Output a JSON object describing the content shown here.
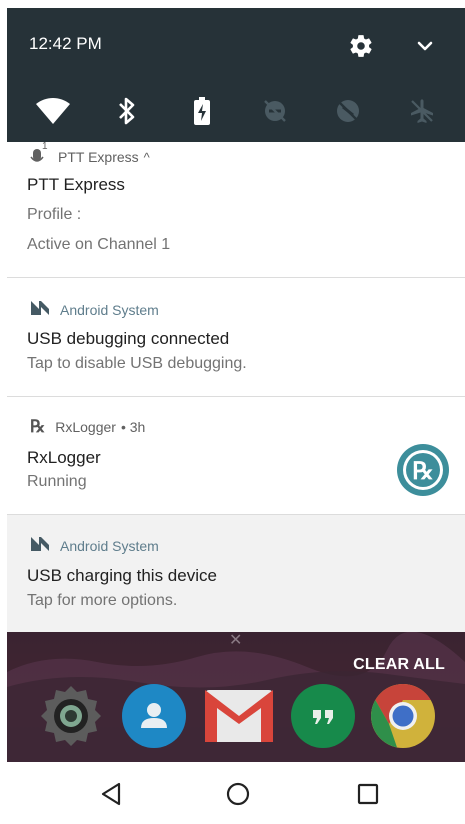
{
  "status": {
    "time": "12:42 PM"
  },
  "icons": {
    "settings": "gear-icon",
    "expand": "chevron-down-icon",
    "wifi": "wifi-icon",
    "bluetooth": "bluetooth-icon",
    "battery": "battery-charging-icon",
    "dnd": "do-not-disturb-off-icon",
    "data_saver": "data-saver-off-icon",
    "airplane": "airplane-mode-icon"
  },
  "notifications": [
    {
      "app": "PTT Express",
      "app_suffix": "^",
      "badge": "1",
      "title": "PTT Express",
      "line1": "Profile :",
      "line2": "Active on Channel 1"
    },
    {
      "app": "Android System",
      "title": "USB debugging connected",
      "text": "Tap to disable USB debugging."
    },
    {
      "app": "RxLogger",
      "time": "• 3h",
      "title": "RxLogger",
      "text": "Running",
      "large_icon": "Rx"
    },
    {
      "app": "Android System",
      "title": "USB charging this device",
      "text": "Tap for more options."
    }
  ],
  "home": {
    "clear_all": "CLEAR ALL",
    "dock": [
      "camera-app-icon",
      "contacts-app-icon",
      "gmail-app-icon",
      "hangouts-app-icon",
      "chrome-app-icon"
    ]
  },
  "nav": {
    "back": "back-icon",
    "home": "home-icon",
    "recents": "recents-icon"
  },
  "colors": {
    "status_bar": "#263238",
    "accent_teal": "#3d8e9b",
    "header_text": "#5f6f78"
  }
}
